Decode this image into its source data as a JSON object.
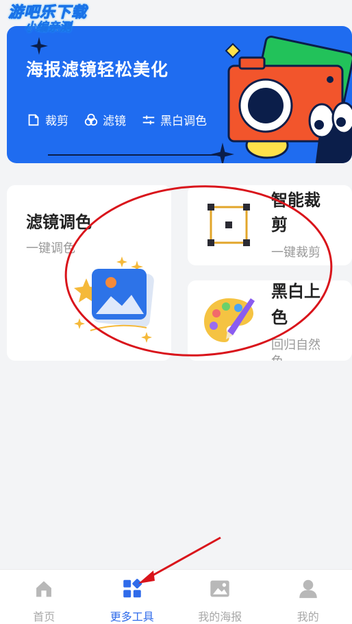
{
  "watermark": {
    "line1": "游吧乐下载",
    "line2": "小编亲测"
  },
  "banner": {
    "title": "海报滤镜轻松美化",
    "features": [
      {
        "icon": "crop-icon",
        "label": "裁剪"
      },
      {
        "icon": "filter-icon",
        "label": "滤镜"
      },
      {
        "icon": "sliders-icon",
        "label": "黑白调色"
      }
    ]
  },
  "tools": {
    "filter": {
      "title": "滤镜调色",
      "subtitle": "一键调色"
    },
    "crop": {
      "title_line1": "智能裁",
      "title_line2": "剪",
      "subtitle": "一键裁剪"
    },
    "bw": {
      "title_line1": "黑白上",
      "title_line2": "色",
      "subtitle": "回归自然",
      "subtitle_cut": "色"
    }
  },
  "nav": {
    "items": [
      {
        "icon": "home-icon",
        "label": "首页",
        "active": false
      },
      {
        "icon": "grid-icon",
        "label": "更多工具",
        "active": true
      },
      {
        "icon": "image-icon",
        "label": "我的海报",
        "active": false
      },
      {
        "icon": "user-icon",
        "label": "我的",
        "active": false
      }
    ]
  },
  "colors": {
    "accent": "#2f6bea",
    "banner_bg": "#1f6cf0",
    "annotation_red": "#d9141b"
  }
}
